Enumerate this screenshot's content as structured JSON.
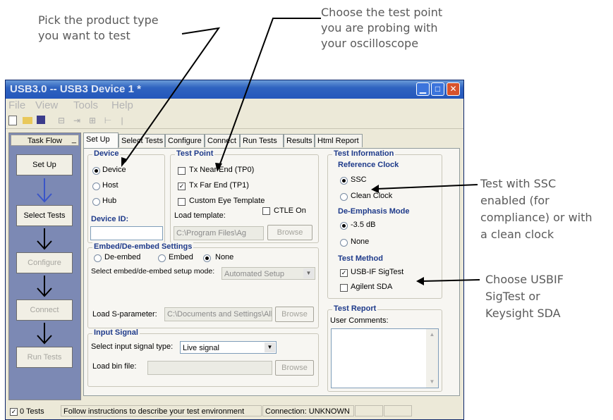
{
  "callouts": {
    "product_type": [
      "Pick the product type",
      "you want to test"
    ],
    "test_point": [
      "Choose the test point",
      "you are probing with",
      "your oscilloscope"
    ],
    "ssc": [
      "Test with SSC",
      "enabled (for",
      "compliance) or with",
      "a clean clock"
    ],
    "sigtest": [
      "Choose USBIF",
      "SigTest or",
      "Keysight SDA"
    ]
  },
  "window": {
    "title": "USB3.0 -- USB3 Device 1 *"
  },
  "menu": [
    "File",
    "View",
    "Tools",
    "Help"
  ],
  "taskflow": {
    "title": "Task Flow",
    "steps": [
      "Set Up",
      "Select Tests",
      "Configure",
      "Connect",
      "Run Tests"
    ]
  },
  "tabs": [
    "Set Up",
    "Select Tests",
    "Configure",
    "Connect",
    "Run Tests",
    "Results",
    "Html Report"
  ],
  "device": {
    "title": "Device",
    "options": [
      "Device",
      "Host",
      "Hub"
    ],
    "selected": "Device",
    "id_label": "Device ID:",
    "id_value": ""
  },
  "test_point": {
    "title": "Test Point",
    "tp0": "Tx Near End (TP0)",
    "tp1": "Tx Far End (TP1)",
    "custom_eye": "Custom Eye Template",
    "ctle": "CTLE On",
    "load_template": "Load template:",
    "template_path": "C:\\Program Files\\Ag",
    "browse": "Browse"
  },
  "embed": {
    "title": "Embed/De-embed Settings",
    "options": [
      "De-embed",
      "Embed",
      "None"
    ],
    "selected": "None",
    "mode_label": "Select embed/de-embed setup mode:",
    "mode_value": "Automated Setup",
    "sparam_label": "Load S-parameter:",
    "sparam_path": "C:\\Documents and Settings\\All",
    "browse": "Browse"
  },
  "input_signal": {
    "title": "Input Signal",
    "type_label": "Select input signal type:",
    "type_value": "Live signal",
    "bin_label": "Load bin file:",
    "bin_value": "",
    "browse": "Browse"
  },
  "test_info": {
    "title": "Test Information",
    "ref_clock": "Reference Clock",
    "ssc": "SSC",
    "clean_clock": "Clean Clock",
    "deemph": "De-Emphasis Mode",
    "db": "-3.5 dB",
    "none": "None",
    "method": "Test Method",
    "sigtest": "USB-IF SigTest",
    "agilent": "Agilent SDA"
  },
  "test_report": {
    "title": "Test Report",
    "comments_label": "User Comments:"
  },
  "status": {
    "tests": "0 Tests",
    "message": "Follow instructions to describe your test environment",
    "connection": "Connection: UNKNOWN"
  }
}
